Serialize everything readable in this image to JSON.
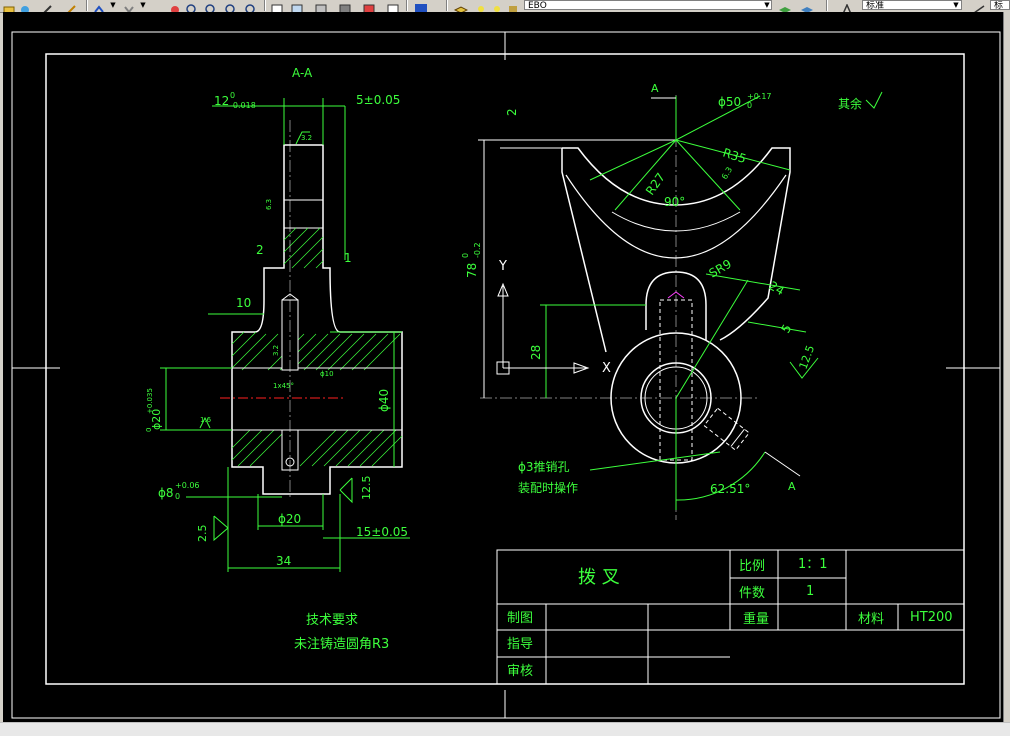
{
  "toolbar": {
    "layer_value": "EBO",
    "style_value": "标准",
    "style_value_2": "标"
  },
  "section": {
    "label": "A-A",
    "dims": {
      "d12": "12",
      "d12_tol_upper": "0",
      "d12_tol_lower": "-0.018",
      "d5": "5±0.05",
      "d2": "2",
      "d1": "1",
      "d10": "10",
      "d40": "ϕ40",
      "d20_bore": "ϕ20",
      "d20_bore_tol": "+0.035",
      "d20_bore_tol2": "0",
      "d8": "ϕ8",
      "d8_tol_upper": "+0.06",
      "d8_tol_lower": "0",
      "d20": "ϕ20",
      "d15": "15±0.05",
      "d34": "34",
      "chamfer": "1x45°",
      "d10_small": "ϕ10",
      "rough_12_5": "12.5",
      "rough_2_5": "2.5",
      "rough_1_6": "1.6",
      "rough_3_2": "3.2",
      "rough_6_3": "6.3",
      "rough_3_2b": "3.2"
    }
  },
  "front": {
    "dims": {
      "d2": "2",
      "d78": "78",
      "d78_tol_upper": "0",
      "d78_tol_lower": "-0.2",
      "r35": "R35",
      "r27": "R27",
      "d90": "90°",
      "d50": "ϕ50",
      "d50_tol_upper": "+0.17",
      "d50_tol_lower": "0",
      "sr9": "SR9",
      "d24": "24",
      "d5": "5",
      "d28": "28",
      "rough_12_5": "12.5",
      "rough_6_3": "6.3",
      "angle": "62.51°",
      "sec_a_top": "A",
      "sec_a_bottom": "A",
      "axis_y": "Y",
      "axis_x": "X"
    },
    "note_pin": "ϕ3推销孔",
    "note_pin2": "装配时操作",
    "remaining_rough": "其余"
  },
  "tech": {
    "title": "技术要求",
    "line1": "未注铸造圆角R3"
  },
  "title_block": {
    "part_name": "拨  叉",
    "scale_label": "比例",
    "scale_value": "1：1",
    "qty_label": "件数",
    "qty_value": "1",
    "weight_label": "重量",
    "material_label": "材料",
    "material_value": "HT200",
    "drawn_label": "制图",
    "guide_label": "指导",
    "review_label": "审核"
  },
  "colors": {
    "background": "#000000",
    "outline": "#ffffff",
    "dimension": "#3cff3c",
    "centerline": "#ff2020"
  }
}
